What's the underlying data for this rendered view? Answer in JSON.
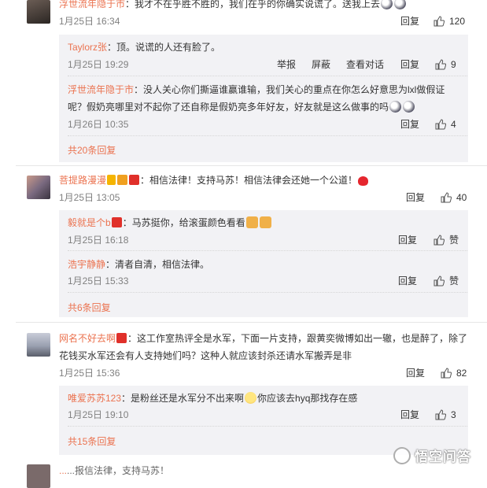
{
  "comments": [
    {
      "user": "浮世流年隐于市",
      "text": "：我才不在乎胜不胜的，我们在乎的你确实说谎了。送我上去",
      "time": "1月25日 16:34",
      "reply_label": "回复",
      "likes": "120"
    },
    {
      "user": "菩提路漫漫",
      "text": "：相信法律！支持马苏！相信法律会还她一个公道！",
      "time": "1月25日 13:05",
      "reply_label": "回复",
      "likes": "40"
    },
    {
      "user": "网名不好去啊",
      "text_line1": "：这工作室热评全是水军，下面一片支持，跟黄奕微博如出一辙，也是醉了，除了",
      "text_line2": "花钱买水军还会有人支持她们吗？这种人就应该封杀还请水军搬弄是非",
      "time": "1月25日 15:36",
      "reply_label": "回复",
      "likes": "82"
    },
    {
      "user": "...",
      "text": "...报信法律，支持马苏！"
    }
  ],
  "replies": [
    {
      "user": "Taylorz张",
      "text": "：顶。说谎的人还有脸了。",
      "time": "1月25日 19:29",
      "report_label": "举报",
      "block_label": "屏蔽",
      "dialog_label": "查看对话",
      "reply_label": "回复",
      "likes": "9"
    },
    {
      "user": "浮世流年隐于市",
      "text_line1": "：没人关心你们撕逼谁赢谁输，我们关心的重点在你怎么好意思为lxl做假证",
      "text_line2": "呢？假奶亮哪里对不起你了还自称是假奶亮多年好友，好友就是这么做事的吗",
      "time": "1月26日 10:35",
      "reply_label": "回复",
      "likes": "4"
    },
    {
      "user": "毅就是个b",
      "text": "：马苏挺你，给滚蛋颜色看看",
      "time": "1月25日 16:18",
      "reply_label": "回复",
      "likes": "赞"
    },
    {
      "user": "浩宇静静",
      "text": "：清者自清，相信法律。",
      "time": "1月25日 15:33",
      "reply_label": "回复",
      "likes": "赞"
    },
    {
      "user": "唯爱苏苏123",
      "text_a": "：是粉丝还是水军分不出来啊",
      "text_b": "你应该去hyq那找存在感",
      "time": "1月25日 19:10",
      "reply_label": "回复",
      "likes": "3"
    }
  ],
  "more_links": [
    "共20条回复",
    "共6条回复",
    "共15条回复"
  ],
  "watermark": "悟空问答",
  "colors": {
    "username": "#eb7350",
    "time": "#808080",
    "reply_bg": "#f2f2f5"
  }
}
